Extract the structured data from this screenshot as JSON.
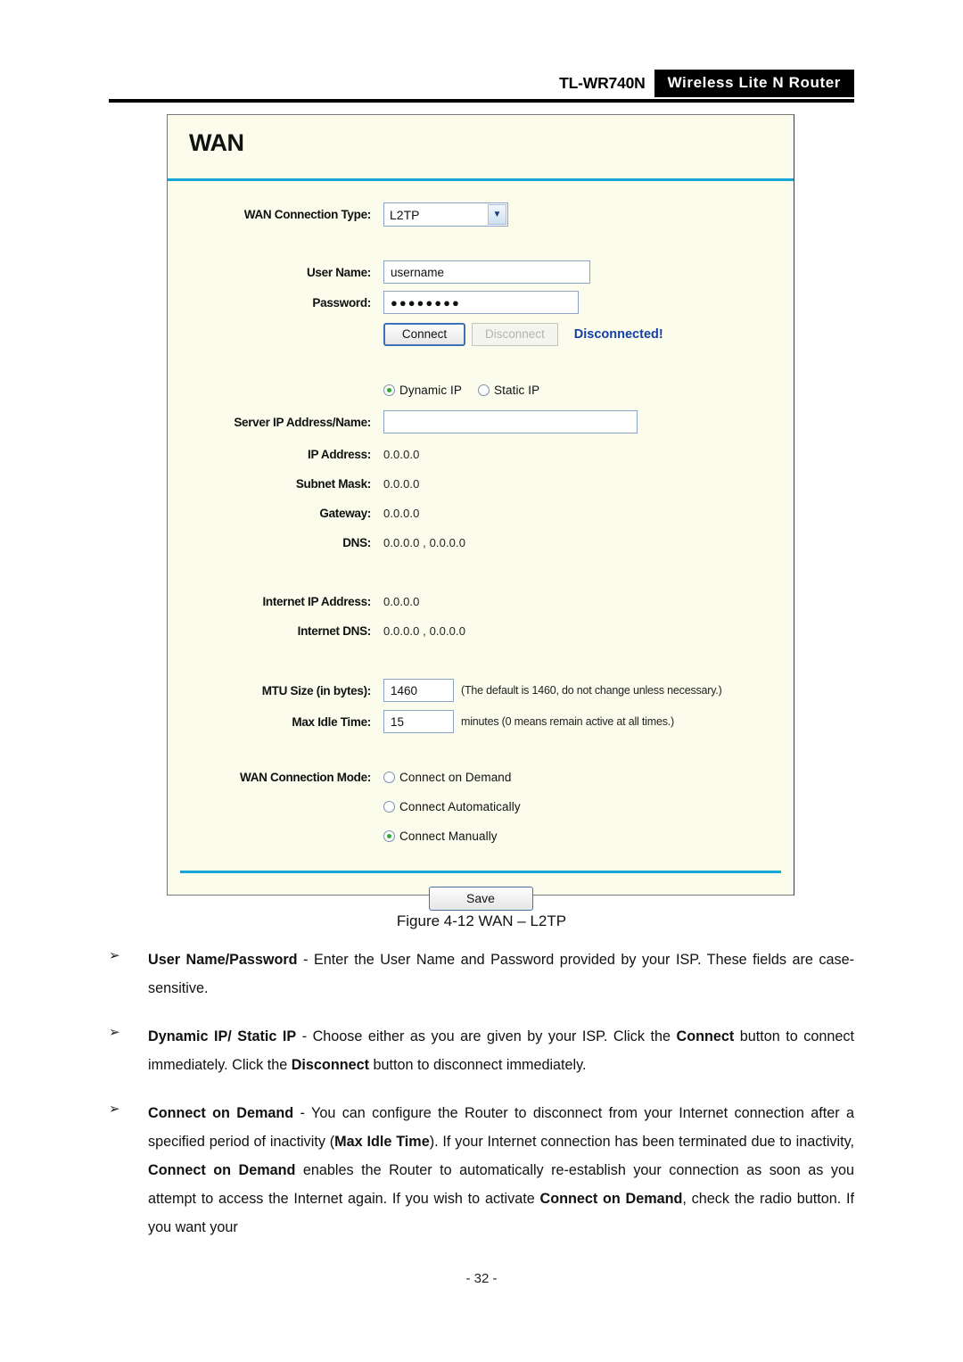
{
  "header": {
    "model": "TL-WR740N",
    "product_badge": "Wireless Lite N Router"
  },
  "panel": {
    "title": "WAN",
    "wan_connection_type": {
      "label": "WAN Connection Type:",
      "selected": "L2TP",
      "arrow_icon": "chevron-down-icon"
    },
    "user_name": {
      "label": "User Name:",
      "value": "username"
    },
    "password": {
      "label": "Password:",
      "value": "●●●●●●●●"
    },
    "connect_button": "Connect",
    "disconnect_button": "Disconnect",
    "connection_status": "Disconnected!",
    "ip_mode": {
      "options": [
        "Dynamic IP",
        "Static IP"
      ],
      "selected": "Dynamic IP"
    },
    "server_ip": {
      "label": "Server IP Address/Name:",
      "value": ""
    },
    "readonly_rows": [
      {
        "label": "IP Address:",
        "value": "0.0.0.0"
      },
      {
        "label": "Subnet Mask:",
        "value": "0.0.0.0"
      },
      {
        "label": "Gateway:",
        "value": "0.0.0.0"
      },
      {
        "label": "DNS:",
        "value": "0.0.0.0 , 0.0.0.0"
      }
    ],
    "internet_rows": [
      {
        "label": "Internet IP Address:",
        "value": "0.0.0.0"
      },
      {
        "label": "Internet DNS:",
        "value": "0.0.0.0 , 0.0.0.0"
      }
    ],
    "mtu": {
      "label": "MTU Size (in bytes):",
      "value": "1460",
      "hint": "(The default is 1460, do not change unless necessary.)"
    },
    "max_idle": {
      "label": "Max Idle Time:",
      "value": "15",
      "hint": "minutes (0 means remain active at all times.)"
    },
    "wan_connection_mode": {
      "label": "WAN Connection Mode:",
      "options": [
        "Connect on Demand",
        "Connect Automatically",
        "Connect Manually"
      ],
      "selected": "Connect Manually"
    },
    "save_button": "Save"
  },
  "caption": "Figure 4-12 WAN – L2TP",
  "bullets": {
    "glyph": "➢",
    "items": [
      {
        "parts": [
          {
            "text": "User Name/Password",
            "bold": true
          },
          {
            "text": " - Enter the User Name and Password provided by your ISP. These fields are case-sensitive.",
            "bold": false
          }
        ]
      },
      {
        "parts": [
          {
            "text": "Dynamic IP/ Static IP",
            "bold": true
          },
          {
            "text": " - Choose either as you are given by your ISP. Click the ",
            "bold": false
          },
          {
            "text": "Connect",
            "bold": true
          },
          {
            "text": " button to connect immediately. Click the ",
            "bold": false
          },
          {
            "text": "Disconnect",
            "bold": true
          },
          {
            "text": " button to disconnect immediately.",
            "bold": false
          }
        ]
      },
      {
        "parts": [
          {
            "text": "Connect on Demand",
            "bold": true
          },
          {
            "text": " - You can configure the Router to disconnect from your Internet connection after a specified period of inactivity (",
            "bold": false
          },
          {
            "text": "Max Idle Time",
            "bold": true
          },
          {
            "text": "). If your Internet connection has been terminated due to inactivity, ",
            "bold": false
          },
          {
            "text": "Connect on Demand",
            "bold": true
          },
          {
            "text": " enables the Router to automatically re-establish your connection as soon as you attempt to access the Internet again. If you wish to activate ",
            "bold": false
          },
          {
            "text": "Connect on Demand",
            "bold": true
          },
          {
            "text": ", check the radio button. If you want your",
            "bold": false
          }
        ]
      }
    ]
  },
  "page_number": "- 32 -",
  "colors": {
    "panel_background": "#fcfcec",
    "accent_rule": "#16a5d4",
    "status_text": "#123fa8",
    "radio_dot": "#2faa2f",
    "badge_background": "#000000"
  }
}
